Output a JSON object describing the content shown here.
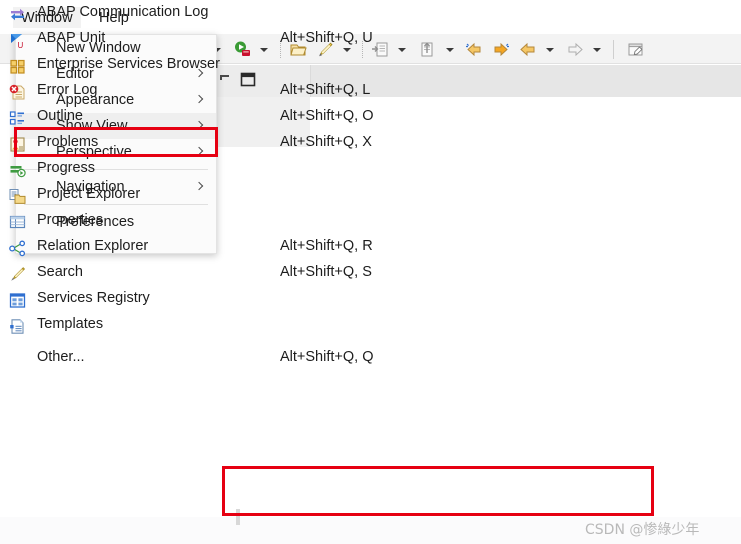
{
  "menubar": {
    "items": [
      {
        "label": "Window",
        "active": true
      },
      {
        "label": "Help",
        "active": false
      }
    ]
  },
  "window_menu": {
    "items": [
      {
        "label": "New Window",
        "submenu": false,
        "highlighted": false
      },
      {
        "label": "Editor",
        "submenu": true,
        "highlighted": false
      },
      {
        "label": "Appearance",
        "submenu": true,
        "highlighted": false
      },
      {
        "label": "Show View",
        "submenu": true,
        "highlighted": true
      },
      {
        "label": "Perspective",
        "submenu": true,
        "highlighted": false
      },
      {
        "label": "Navigation",
        "submenu": true,
        "highlighted": false
      },
      {
        "label": "Preferences",
        "submenu": false,
        "highlighted": false
      }
    ]
  },
  "show_view_menu": {
    "items": [
      {
        "label": "ABAP Communication Log",
        "shortcut": "",
        "icon": "abap-communication-log-icon"
      },
      {
        "label": "ABAP Unit",
        "shortcut": "Alt+Shift+Q, U",
        "icon": "abap-unit-icon"
      },
      {
        "label": "Enterprise Services Browser",
        "shortcut": "",
        "icon": "enterprise-services-browser-icon"
      },
      {
        "label": "Error Log",
        "shortcut": "Alt+Shift+Q, L",
        "icon": "error-log-icon"
      },
      {
        "label": "Outline",
        "shortcut": "Alt+Shift+Q, O",
        "icon": "outline-icon"
      },
      {
        "label": "Problems",
        "shortcut": "Alt+Shift+Q, X",
        "icon": "problems-icon"
      },
      {
        "label": "Progress",
        "shortcut": "",
        "icon": "progress-icon"
      },
      {
        "label": "Project Explorer",
        "shortcut": "",
        "icon": "project-explorer-icon"
      },
      {
        "label": "Properties",
        "shortcut": "",
        "icon": "properties-icon"
      },
      {
        "label": "Relation Explorer",
        "shortcut": "Alt+Shift+Q, R",
        "icon": "relation-explorer-icon"
      },
      {
        "label": "Search",
        "shortcut": "Alt+Shift+Q, S",
        "icon": "search-icon"
      },
      {
        "label": "Services Registry",
        "shortcut": "",
        "icon": "services-registry-icon"
      },
      {
        "label": "Templates",
        "shortcut": "",
        "icon": "templates-icon"
      }
    ],
    "other_item": {
      "label": "Other...",
      "shortcut": "Alt+Shift+Q, Q"
    }
  },
  "annotations": {
    "color": "#e60012",
    "boxes": [
      {
        "name": "show-view-highlight"
      },
      {
        "name": "other-highlight"
      }
    ]
  },
  "watermark": {
    "text": "CSDN @惨綠少年"
  },
  "toolbar": {
    "icons": [
      "run-icon",
      "dropdown-arrow",
      "open-folder-icon",
      "pencil-icon",
      "dropdown-arrow",
      "import-icon",
      "dropdown-arrow",
      "export-icon",
      "dropdown-arrow",
      "back-all-icon",
      "forward-all-icon",
      "back-icon",
      "dropdown-arrow",
      "forward-icon",
      "dropdown-arrow",
      "new-editor-icon"
    ]
  }
}
